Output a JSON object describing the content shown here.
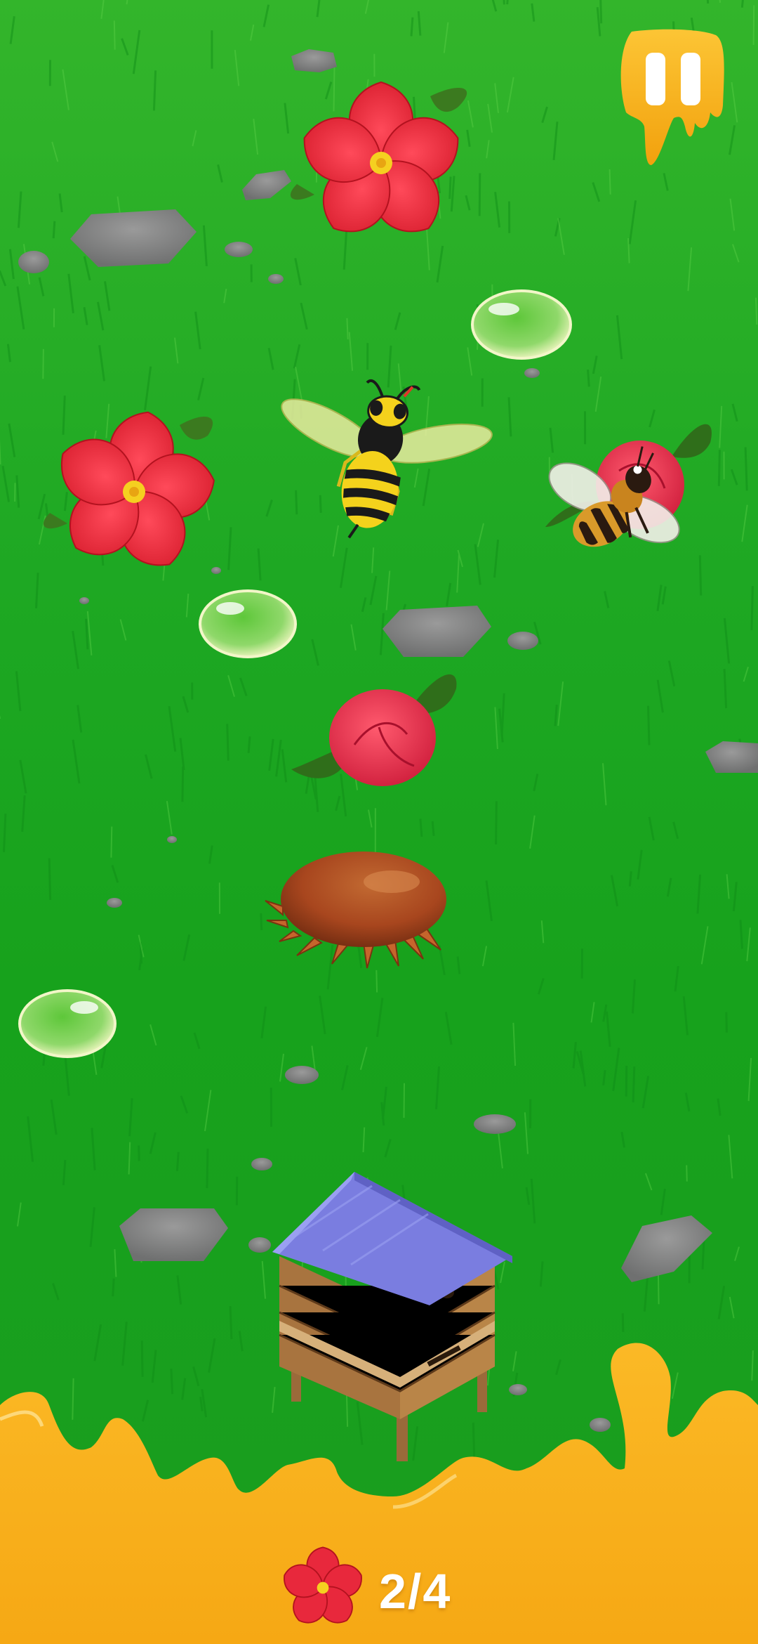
{
  "game": {
    "collected": 2,
    "target": 4,
    "counter_label": "2/4"
  },
  "pause": {
    "icon": "pause-icon"
  },
  "colors": {
    "grass_light": "#3cbf2e",
    "grass_dark": "#159a1b",
    "flower_red": "#e8283c",
    "flower_center": "#f5d020",
    "honey": "#f7b417",
    "honey_dark": "#e89a0c",
    "water_drop": "#b9e89a",
    "hive_roof": "#7a7de0",
    "hive_wood": "#a8743f",
    "mite": "#a8461e",
    "wasp_yellow": "#f4d21c",
    "bee_body": "#d99a2a"
  },
  "entities": {
    "flowers_open": 2,
    "flower_buds": 2,
    "water_drops": 3,
    "wasp": "hornet-enemy",
    "bee": "player-bee",
    "mite": "varroa-mite-enemy",
    "hive": "beehive"
  }
}
